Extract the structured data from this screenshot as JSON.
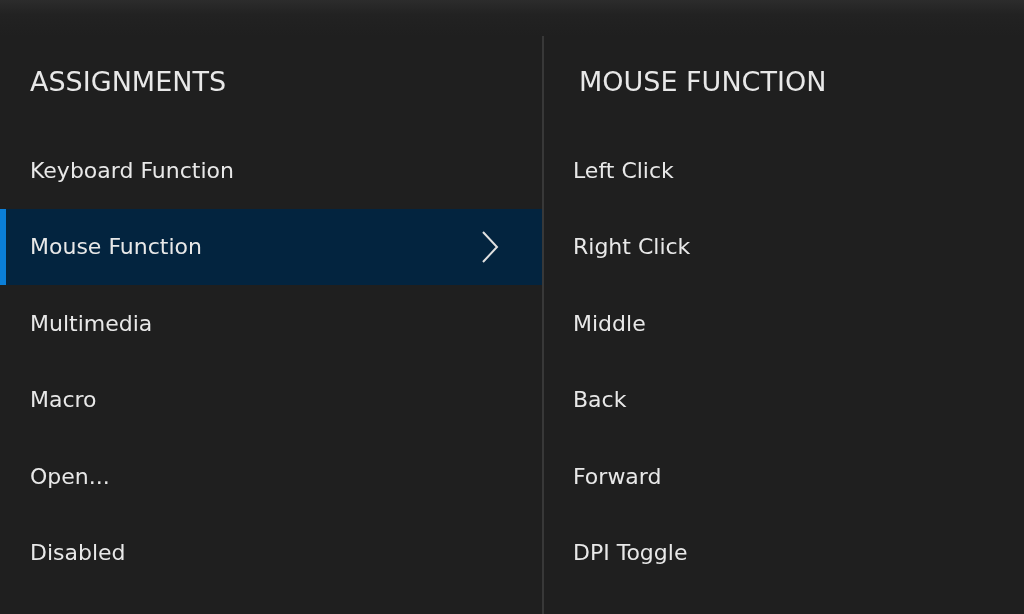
{
  "assignments": {
    "title": "ASSIGNMENTS",
    "items": [
      {
        "label": "Keyboard Function",
        "selected": false
      },
      {
        "label": "Mouse Function",
        "selected": true
      },
      {
        "label": "Multimedia",
        "selected": false
      },
      {
        "label": "Macro",
        "selected": false
      },
      {
        "label": "Open...",
        "selected": false
      },
      {
        "label": "Disabled",
        "selected": false
      }
    ]
  },
  "mouse_function": {
    "title": "MOUSE FUNCTION",
    "items": [
      {
        "label": "Left Click"
      },
      {
        "label": "Right Click"
      },
      {
        "label": "Middle"
      },
      {
        "label": "Back"
      },
      {
        "label": "Forward"
      },
      {
        "label": "DPI Toggle"
      }
    ]
  }
}
